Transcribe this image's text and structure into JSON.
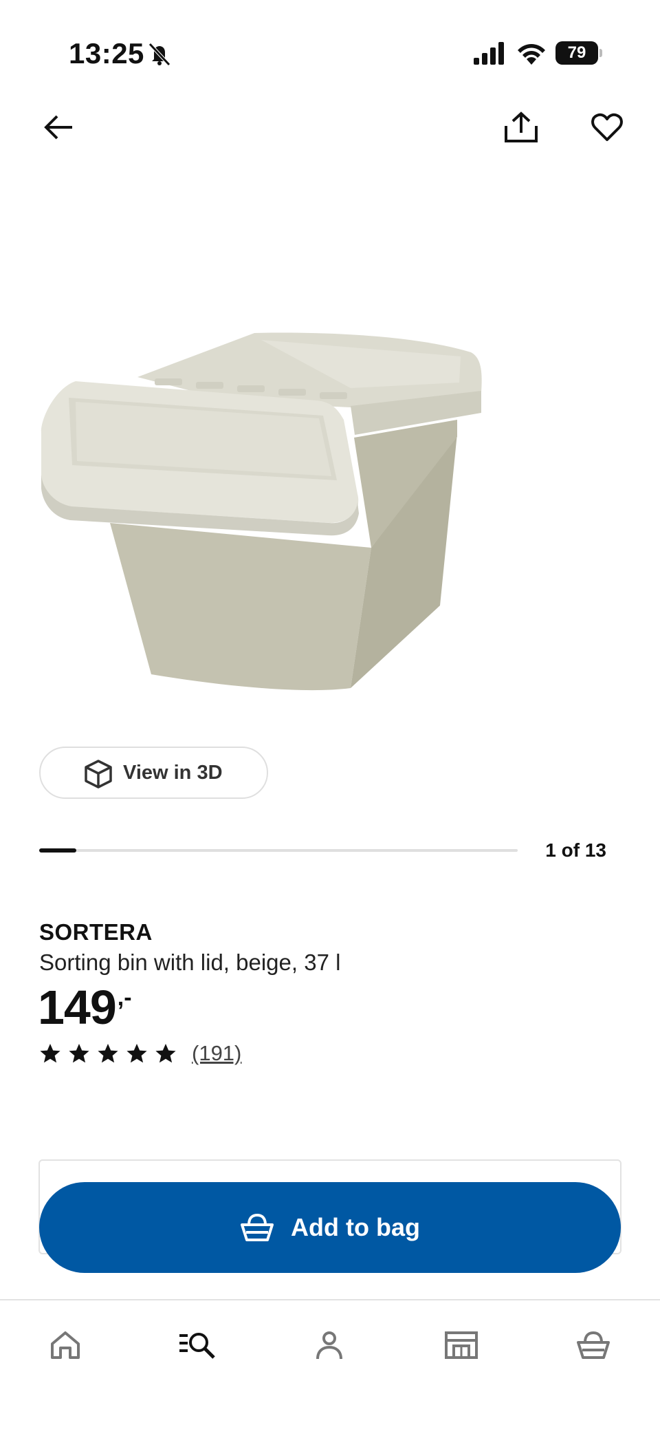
{
  "status_bar": {
    "time": "13:25",
    "battery": "79"
  },
  "icons": {
    "back": "arrow-left-icon",
    "share": "share-icon",
    "favorite": "heart-icon",
    "view3d": "cube-icon",
    "basket": "basket-icon",
    "nav_home": "home-icon",
    "nav_search": "search-icon",
    "nav_profile": "user-icon",
    "nav_store": "store-icon",
    "nav_bag": "shopping-bag-icon"
  },
  "gallery": {
    "view3d_label": "View in 3D",
    "position_label": "1 of 13",
    "current_image": 1,
    "total_images": 13
  },
  "product": {
    "name": "SORTERA",
    "description": "Sorting bin with lid, beige, 37 l",
    "price": "149",
    "price_suffix": ",-",
    "rating": 5,
    "rating_max": 5,
    "review_count": "(191)"
  },
  "cta": {
    "add_to_bag_label": "Add to bag"
  },
  "colors": {
    "accent": "#0058a3",
    "text": "#111111",
    "bin": "#d8d7c8"
  }
}
